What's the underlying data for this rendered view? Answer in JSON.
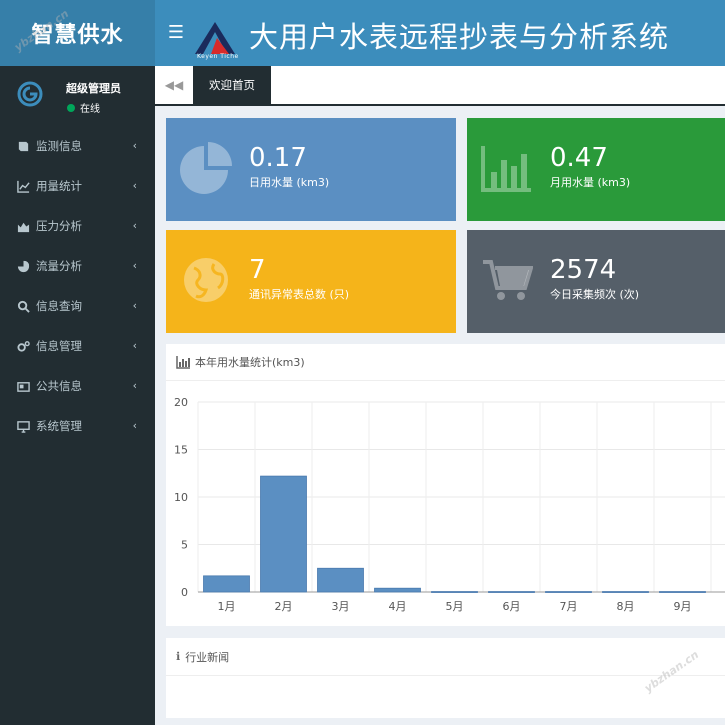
{
  "header": {
    "app_name": "智慧供水",
    "menu_icon": "hamburger-icon",
    "brand_sub": "Keyen Tiche",
    "system_title": "大用户水表远程抄表与分析系统"
  },
  "user": {
    "name": "超级管理员",
    "status": "在线",
    "status_color": "#00a65a"
  },
  "sidebar": {
    "items": [
      {
        "label": "监测信息",
        "icon": "book-icon"
      },
      {
        "label": "用量统计",
        "icon": "line-chart-icon"
      },
      {
        "label": "压力分析",
        "icon": "area-chart-icon"
      },
      {
        "label": "流量分析",
        "icon": "pie-chart-icon"
      },
      {
        "label": "信息查询",
        "icon": "search-icon"
      },
      {
        "label": "信息管理",
        "icon": "gears-icon"
      },
      {
        "label": "公共信息",
        "icon": "newspaper-icon"
      },
      {
        "label": "系统管理",
        "icon": "desktop-icon"
      }
    ],
    "chevron": "‹"
  },
  "tabs": {
    "back_icon": "double-left-icon",
    "active_label": "欢迎首页"
  },
  "stats": [
    {
      "value": "0.17",
      "label": "日用水量 (km3)",
      "icon": "pie-chart-icon",
      "color": "#5b8fc2"
    },
    {
      "value": "0.47",
      "label": "月用水量 (km3)",
      "icon": "bar-chart-icon",
      "color": "#2a9a3a"
    },
    {
      "value": "7",
      "label": "通讯异常表总数 (只)",
      "icon": "globe-icon",
      "color": "#f5b41a"
    },
    {
      "value": "2574",
      "label": "今日采集频次 (次)",
      "icon": "cart-icon",
      "color": "#555f69"
    }
  ],
  "chart_panel": {
    "title": "本年用水量统计(km3)",
    "icon": "bar-chart-icon"
  },
  "news_panel": {
    "title": "行业新闻",
    "icon": "info-icon"
  },
  "chart_data": {
    "type": "bar",
    "title": "本年用水量统计(km3)",
    "categories": [
      "1月",
      "2月",
      "3月",
      "4月",
      "5月",
      "6月",
      "7月",
      "8月",
      "9月"
    ],
    "values": [
      1.7,
      12.2,
      2.5,
      0.4,
      0.05,
      0.05,
      0.05,
      0.05,
      0.05
    ],
    "ylim": [
      0,
      20
    ],
    "yticks": [
      0,
      5,
      10,
      15,
      20
    ],
    "bar_color": "#5b8fc2",
    "grid": true
  },
  "watermarks": [
    "ybzhan.cn",
    "ybzhan.cn"
  ]
}
